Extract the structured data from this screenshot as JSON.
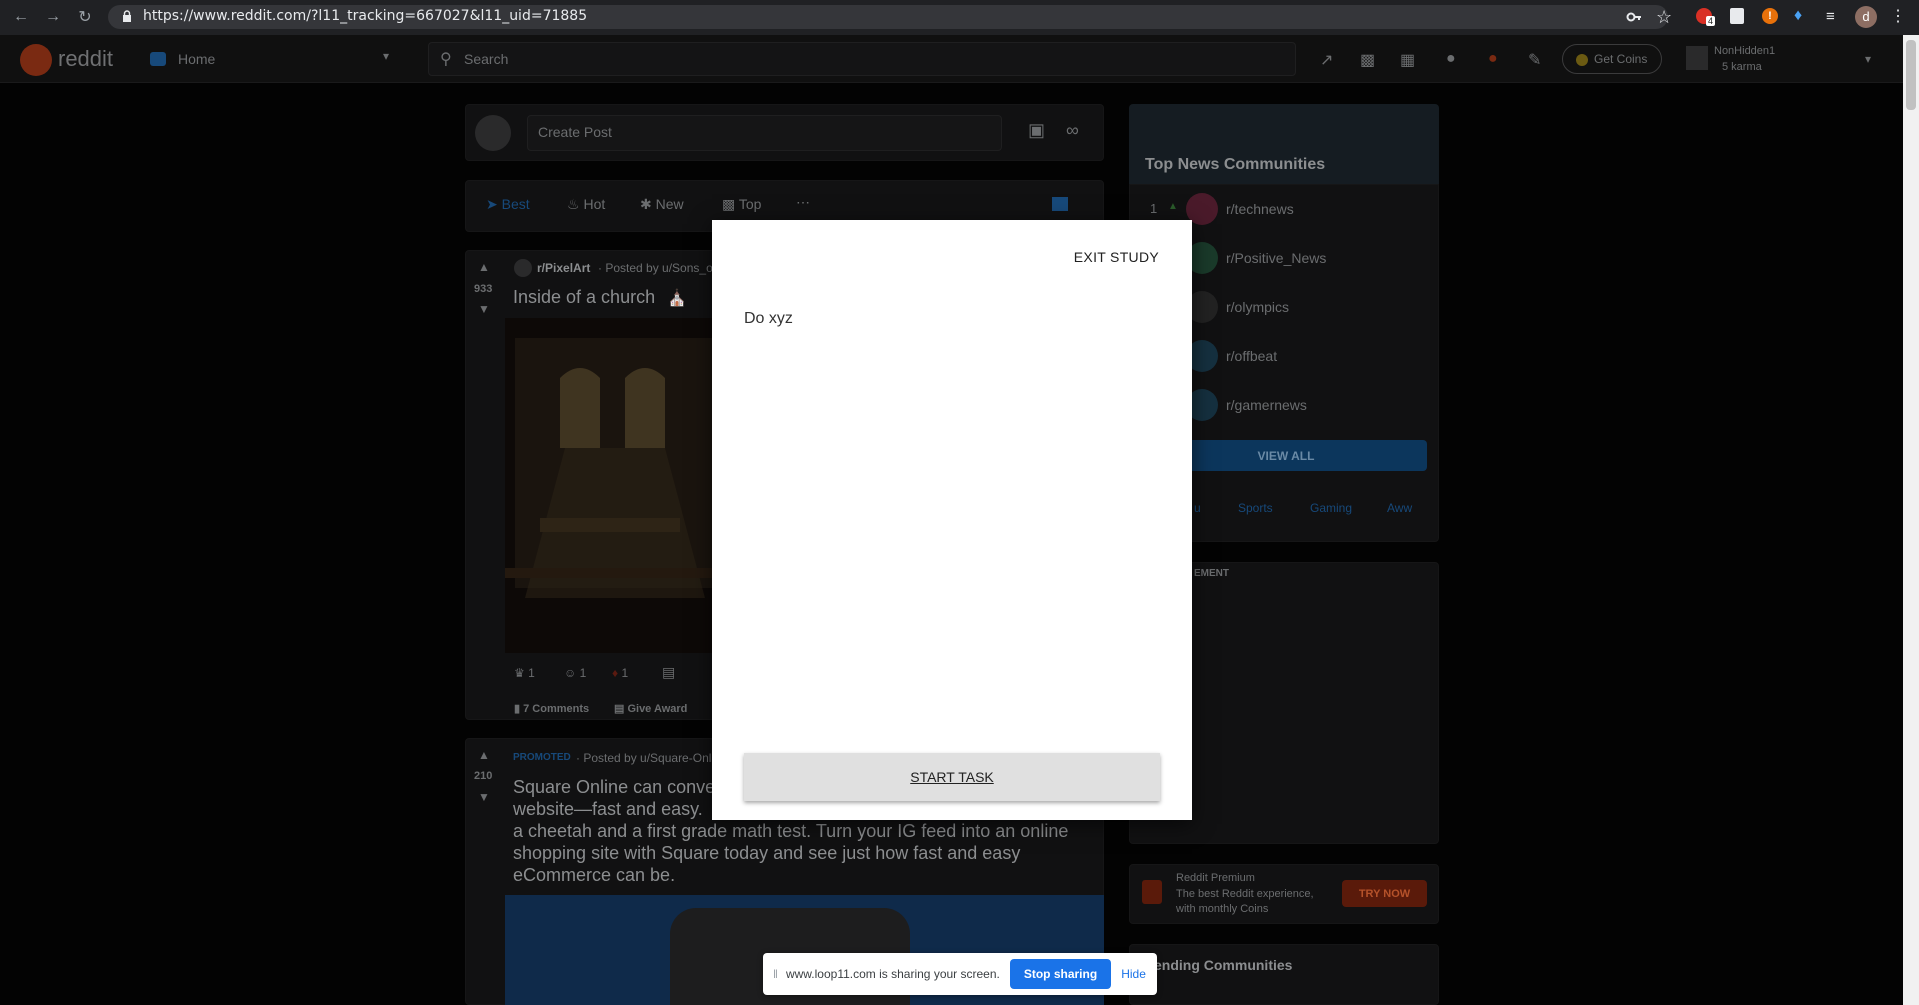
{
  "browser": {
    "url": "https://www.reddit.com/?l11_tracking=667027&l11_uid=71885",
    "avatar_letter": "d",
    "ext_badge": "4"
  },
  "header": {
    "logo_text": "reddit",
    "home_label": "Home",
    "search_placeholder": "Search",
    "get_coins_label": "Get Coins",
    "username": "NonHidden1",
    "karma": "5 karma"
  },
  "feed": {
    "create_post_placeholder": "Create Post",
    "sort_tabs": [
      "Best",
      "Hot",
      "New",
      "Top"
    ],
    "post1": {
      "votes": "933",
      "subreddit": "r/PixelArt",
      "posted_by": "· Posted by u/Sons_o",
      "title": "Inside of a church",
      "awards": [
        "1",
        "1",
        "1"
      ],
      "comments": "7 Comments",
      "give_award": "Give Award"
    },
    "post2": {
      "votes": "210",
      "promoted": "PROMOTED",
      "posted_by": "· Posted by u/Square-Onl",
      "title_lines": [
        "Square Online can conve",
        "website—fast and easy.",
        "a cheetah and a first grade math test. Turn your IG feed into an online",
        "shopping site with Square today and see just how fast and easy",
        "eCommerce can be."
      ]
    }
  },
  "sidebar": {
    "banner_title": "Top News Communities",
    "rank1": "1",
    "communities": [
      "r/technews",
      "r/Positive_News",
      "r/olympics",
      "r/offbeat",
      "r/gamernews"
    ],
    "view_all": "VIEW ALL",
    "topic_tabs": [
      "u",
      "Sports",
      "Gaming",
      "Aww"
    ],
    "ad_label": "EMENT",
    "premium_title": "Reddit Premium",
    "premium_desc_1": "The best Reddit experience,",
    "premium_desc_2": "with monthly Coins",
    "try_now": "TRY NOW",
    "trending": "ending Communities"
  },
  "modal": {
    "exit_label": "EXIT STUDY",
    "task_text": "Do xyz",
    "start_label": "START TASK"
  },
  "sharebar": {
    "message": "www.loop11.com is sharing your screen.",
    "stop_label": "Stop sharing",
    "hide_label": "Hide"
  },
  "colors": {
    "reddit_orange": "#ff4500",
    "blue": "#0079d3",
    "share_blue": "#1a73e8"
  }
}
